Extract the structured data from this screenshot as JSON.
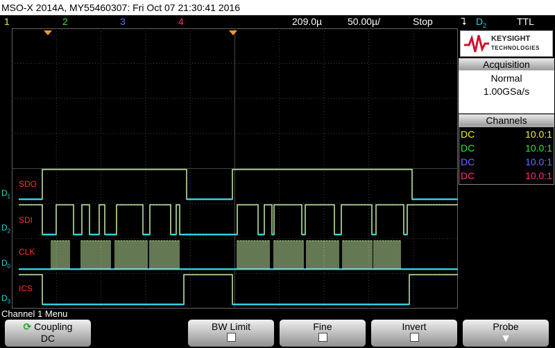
{
  "title": "MSO-X 2014A, MY55460307: Fri Oct 07 21:30:41 2016",
  "status": {
    "channels": [
      {
        "label": "1",
        "color": "#f0f040"
      },
      {
        "label": "2",
        "color": "#40e040"
      },
      {
        "label": "3",
        "color": "#6a6aff"
      },
      {
        "label": "4",
        "color": "#ff3070"
      }
    ],
    "timebase": "209.0µ",
    "time_per_div": "50.00µ/",
    "run_state": "Stop",
    "trigger_source": "D",
    "trigger_source_sub": "2",
    "trigger_level": "TTL"
  },
  "logo": {
    "brand": "KEYSIGHT",
    "sub": "TECHNOLOGIES"
  },
  "acquisition": {
    "header": "Acquisition",
    "mode": "Normal",
    "rate": "1.00GSa/s"
  },
  "channels_panel": {
    "header": "Channels",
    "rows": [
      {
        "coupling": "DC",
        "ratio": "10.0:1",
        "color": "#f0f040"
      },
      {
        "coupling": "DC",
        "ratio": "10.0:1",
        "color": "#40e040"
      },
      {
        "coupling": "DC",
        "ratio": "10.0:1",
        "color": "#6a6aff"
      },
      {
        "coupling": "DC",
        "ratio": "10.0:1",
        "color": "#ff3070"
      }
    ]
  },
  "digital_labels": [
    {
      "name": "SDO",
      "ch": "D",
      "sub": "1"
    },
    {
      "name": "SDI",
      "ch": "D",
      "sub": "2"
    },
    {
      "name": "CLK",
      "ch": "D",
      "sub": "0"
    },
    {
      "name": "ICS",
      "ch": "D",
      "sub": "3"
    }
  ],
  "menu": {
    "title": "Channel 1 Menu"
  },
  "softkeys": {
    "coupling": {
      "label": "Coupling",
      "value": "DC"
    },
    "bw_limit": {
      "label": "BW Limit"
    },
    "fine": {
      "label": "Fine"
    },
    "invert": {
      "label": "Invert"
    },
    "probe": {
      "label": "Probe"
    }
  },
  "colors": {
    "trace": "#30d0e0",
    "trace_high": "#b8f0a0",
    "label": "#ff3030",
    "grid": "#5a5a5a"
  }
}
